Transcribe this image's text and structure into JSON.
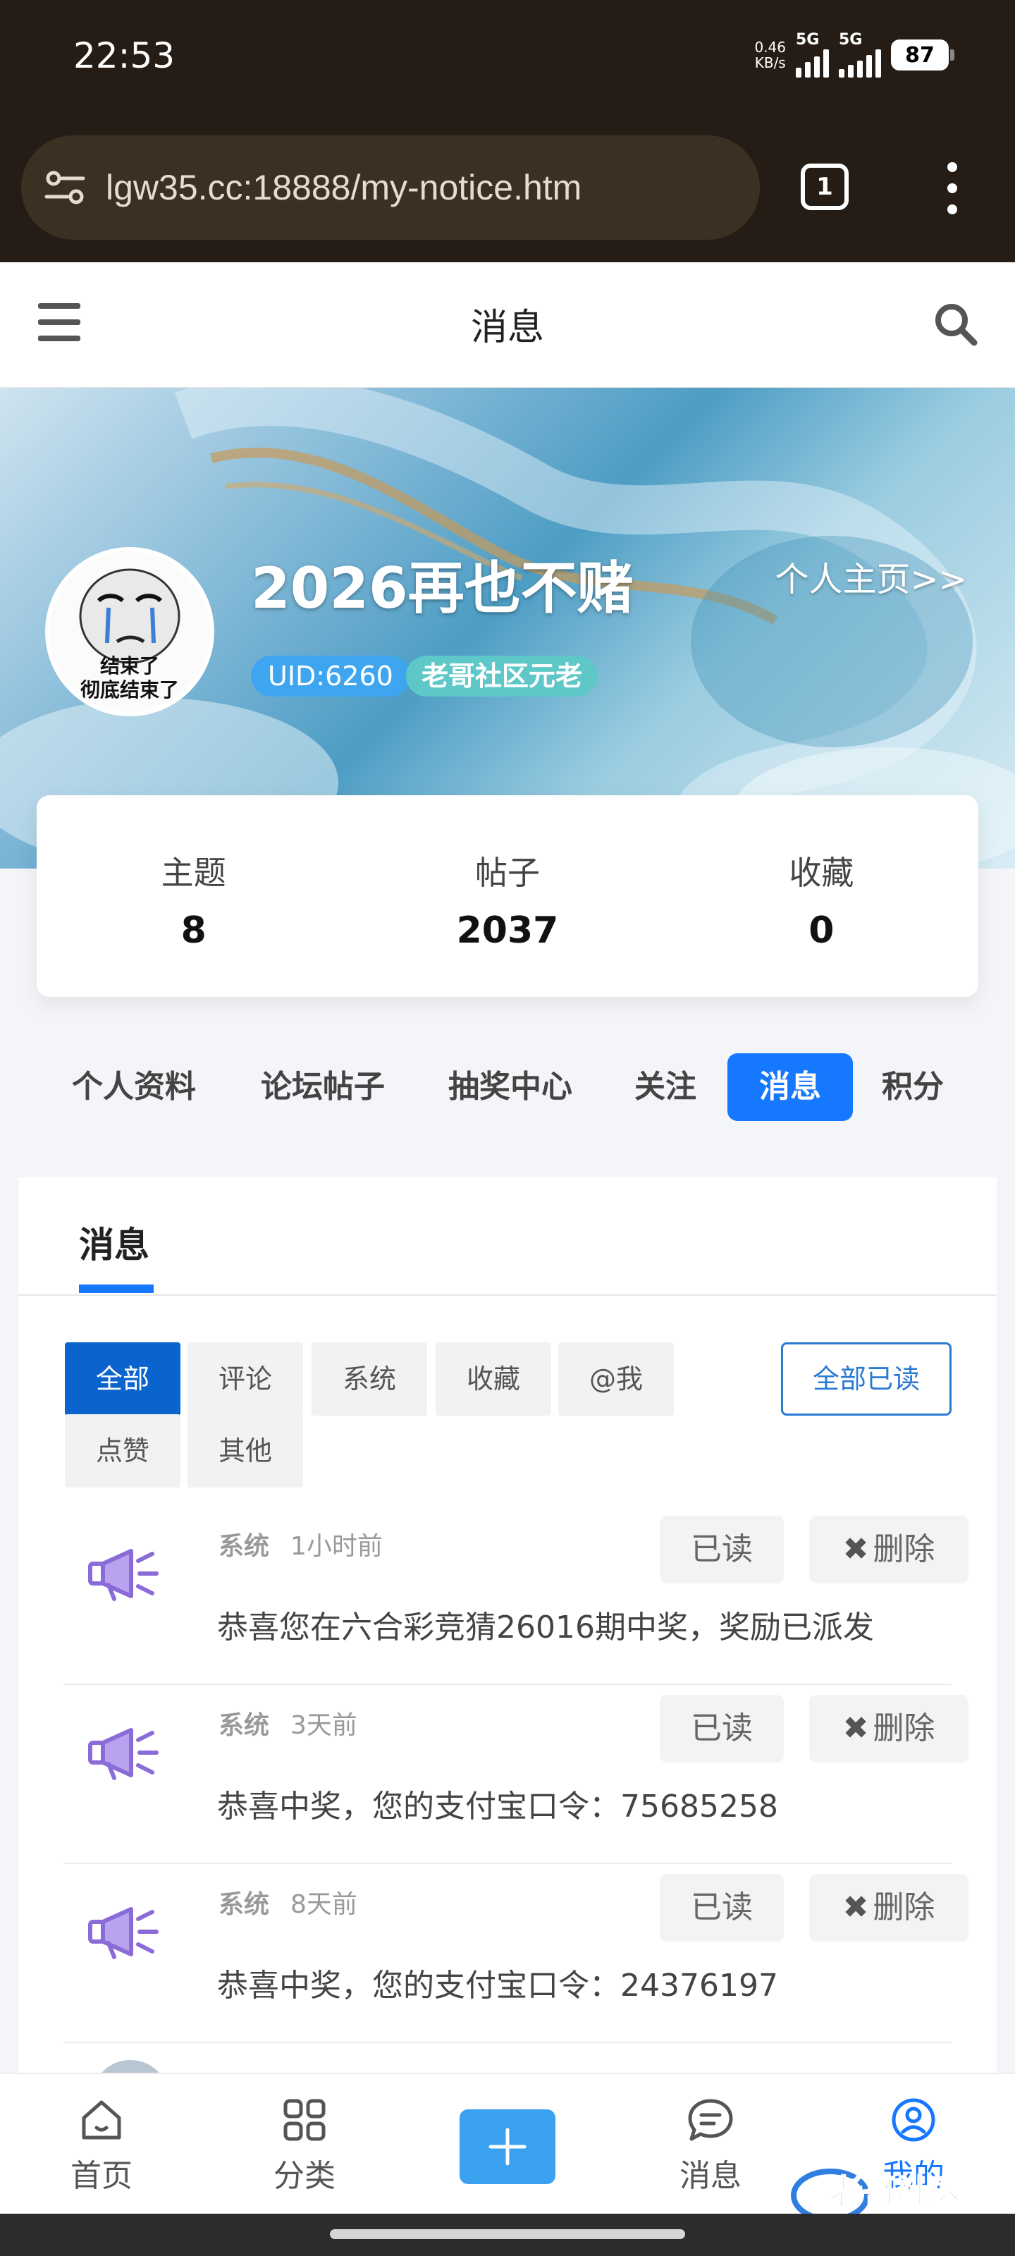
{
  "status_bar": {
    "time": "22:53",
    "net_speed_value": "0.46",
    "net_speed_unit": "KB/s",
    "sim1": "5G",
    "sim2": "5G",
    "battery": "87"
  },
  "browser": {
    "url": "lgw35.cc:18888/my-notice.htm",
    "tab_count": "1"
  },
  "header": {
    "title": "消息"
  },
  "profile": {
    "username": "2026再也不赌",
    "avatar_caption_line1": "结束了",
    "avatar_caption_line2": "彻底结束了",
    "homepage_link": "个人主页>>",
    "uid": "UID:6260",
    "rank": "老哥社区元老"
  },
  "stats": [
    {
      "label": "主题",
      "value": "8"
    },
    {
      "label": "帖子",
      "value": "2037"
    },
    {
      "label": "收藏",
      "value": "0"
    }
  ],
  "profile_tabs": [
    "个人资料",
    "论坛帖子",
    "抽奖中心",
    "关注",
    "消息",
    "积分"
  ],
  "profile_tab_active": "消息",
  "panel": {
    "title": "消息",
    "filters": [
      "全部",
      "评论",
      "系统",
      "收藏",
      "@我",
      "点赞",
      "其他"
    ],
    "filter_active": "全部",
    "mark_all_read": "全部已读"
  },
  "messages": [
    {
      "type": "系统",
      "time": "1小时前",
      "read_label": "已读",
      "delete_label": "删除",
      "body": "恭喜您在六合彩竞猜26016期中奖，奖励已派发"
    },
    {
      "type": "系统",
      "time": "3天前",
      "read_label": "已读",
      "delete_label": "删除",
      "body": "恭喜中奖，您的支付宝口令：75685258"
    },
    {
      "type": "系统",
      "time": "8天前",
      "read_label": "已读",
      "delete_label": "删除",
      "body": "恭喜中奖，您的支付宝口令：24376197"
    }
  ],
  "bottom_nav": {
    "items": [
      {
        "label": "首页",
        "icon": "home-icon"
      },
      {
        "label": "分类",
        "icon": "grid-icon"
      },
      {
        "label": "",
        "icon": "plus-icon"
      },
      {
        "label": "消息",
        "icon": "chat-icon"
      },
      {
        "label": "我的",
        "icon": "user-circle-icon"
      }
    ],
    "active": "我的"
  },
  "watermark": {
    "text": "老哥社区",
    "subtext": "LAOGESHEQU"
  },
  "colors": {
    "accent": "#1677ff",
    "filter_active": "#0b63ce",
    "uid_badge": "#3ea6f0",
    "rank_badge": "#5ec8c8",
    "browser_chrome": "#241c15"
  }
}
